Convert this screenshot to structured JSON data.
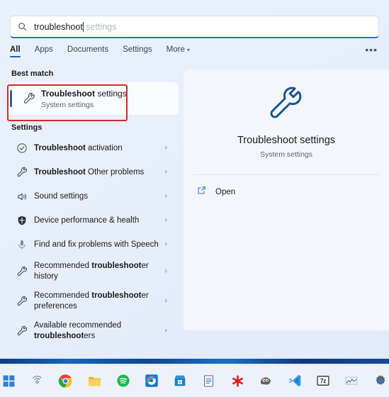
{
  "search": {
    "typed_text": "troubleshoot",
    "suggestion_text": " settings",
    "icon": "search-icon"
  },
  "tabs": [
    {
      "label": "All",
      "active": true
    },
    {
      "label": "Apps",
      "active": false
    },
    {
      "label": "Documents",
      "active": false
    },
    {
      "label": "Settings",
      "active": false
    },
    {
      "label": "More",
      "active": false,
      "has_chevron": true
    }
  ],
  "overflow_label": "•••",
  "sections": {
    "best_match_label": "Best match",
    "settings_label": "Settings"
  },
  "best_match": {
    "title_bold": "Troubleshoot",
    "title_rest": " settings",
    "subtitle": "System settings",
    "icon": "wrench-icon"
  },
  "settings_results": [
    {
      "icon": "check-circle-icon",
      "bold": "Troubleshoot",
      "rest": " activation",
      "chevron": "›"
    },
    {
      "icon": "wrench-icon",
      "bold": "Troubleshoot",
      "rest": " Other problems",
      "chevron": "›"
    },
    {
      "icon": "speaker-icon",
      "bold": "",
      "rest": "Sound settings",
      "chevron": "›"
    },
    {
      "icon": "shield-icon",
      "bold": "",
      "rest": "Device performance & health",
      "chevron": "›"
    },
    {
      "icon": "microphone-icon",
      "bold": "",
      "rest": "Find and fix problems with Speech",
      "chevron": "›"
    },
    {
      "icon": "wrench-icon",
      "pre": "Recommended ",
      "bold": "troubleshoot",
      "rest": "er history",
      "chevron": "›"
    },
    {
      "icon": "wrench-icon",
      "pre": "Recommended ",
      "bold": "troubleshoot",
      "rest": "er preferences",
      "chevron": "›"
    },
    {
      "icon": "wrench-icon",
      "pre": "Available recommended ",
      "bold": "troubleshoot",
      "rest": "ers",
      "chevron": "›"
    }
  ],
  "preview": {
    "icon": "wrench-icon",
    "title": "Troubleshoot settings",
    "subtitle": "System settings",
    "open_label": "Open",
    "open_icon": "external-link-icon"
  },
  "taskbar": [
    {
      "name": "start-button",
      "icon": "windows-logo-icon"
    },
    {
      "name": "taskbar-search",
      "icon": "radar-icon"
    },
    {
      "name": "taskbar-chrome",
      "icon": "chrome-icon"
    },
    {
      "name": "taskbar-file-explorer",
      "icon": "folder-icon"
    },
    {
      "name": "taskbar-spotify",
      "icon": "spotify-icon"
    },
    {
      "name": "taskbar-app-blue",
      "icon": "blue-app-icon"
    },
    {
      "name": "taskbar-microsoft-store",
      "icon": "store-icon"
    },
    {
      "name": "taskbar-notepad",
      "icon": "notepad-icon"
    },
    {
      "name": "taskbar-red-app",
      "icon": "red-asterisk-icon"
    },
    {
      "name": "taskbar-gimp",
      "icon": "gimp-icon"
    },
    {
      "name": "taskbar-vscode",
      "icon": "vscode-icon"
    },
    {
      "name": "taskbar-7zip",
      "icon": "sevenzip-icon"
    },
    {
      "name": "taskbar-chart-app",
      "icon": "chart-icon"
    },
    {
      "name": "taskbar-settings",
      "icon": "gear-icon"
    }
  ],
  "colors": {
    "accent": "#1565c0",
    "annotation": "#d22b2b",
    "panel": "#f5f6fb"
  }
}
